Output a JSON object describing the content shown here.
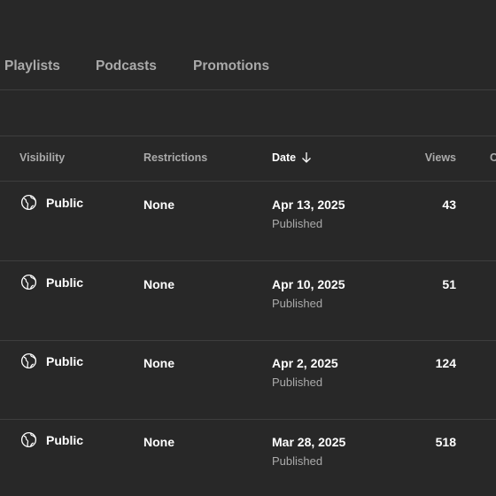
{
  "tabs": [
    {
      "label": "Playlists"
    },
    {
      "label": "Podcasts"
    },
    {
      "label": "Promotions"
    }
  ],
  "table": {
    "headers": {
      "visibility": "Visibility",
      "restrictions": "Restrictions",
      "date": "Date",
      "views": "Views",
      "comments": "C"
    },
    "sort": {
      "column": "date",
      "direction": "descending",
      "icon": "arrow-down-icon"
    },
    "rows": [
      {
        "visibility": "Public",
        "visibility_icon": "globe-icon",
        "restrictions": "None",
        "date": "Apr 13, 2025",
        "status": "Published",
        "views": "43"
      },
      {
        "visibility": "Public",
        "visibility_icon": "globe-icon",
        "restrictions": "None",
        "date": "Apr 10, 2025",
        "status": "Published",
        "views": "51"
      },
      {
        "visibility": "Public",
        "visibility_icon": "globe-icon",
        "restrictions": "None",
        "date": "Apr 2, 2025",
        "status": "Published",
        "views": "124"
      },
      {
        "visibility": "Public",
        "visibility_icon": "globe-icon",
        "restrictions": "None",
        "date": "Mar 28, 2025",
        "status": "Published",
        "views": "518"
      }
    ]
  },
  "colors": {
    "background": "#282828",
    "divider": "#3e3e3e",
    "text_primary": "#ffffff",
    "text_secondary": "#aaaaaa"
  }
}
